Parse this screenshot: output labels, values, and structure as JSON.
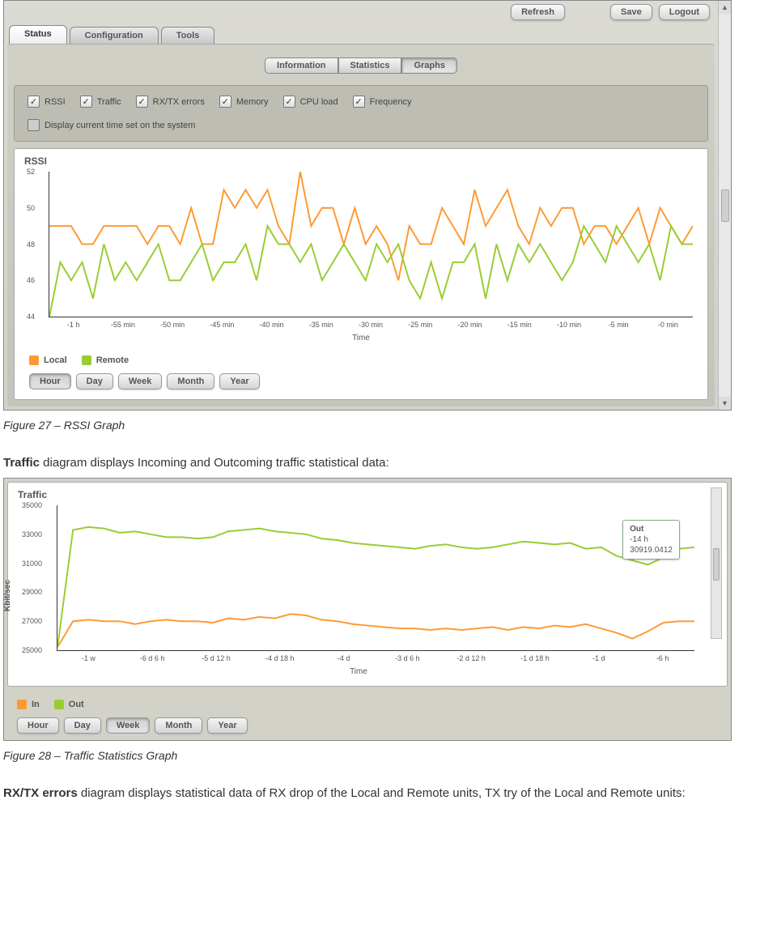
{
  "header_buttons": {
    "refresh": "Refresh",
    "save": "Save",
    "logout": "Logout"
  },
  "main_tabs": [
    {
      "label": "Status",
      "active": true
    },
    {
      "label": "Configuration",
      "active": false
    },
    {
      "label": "Tools",
      "active": false
    }
  ],
  "sub_tabs": [
    {
      "label": "Information",
      "active": false
    },
    {
      "label": "Statistics",
      "active": false
    },
    {
      "label": "Graphs",
      "active": true
    }
  ],
  "checkboxes": [
    {
      "label": "RSSI",
      "checked": true
    },
    {
      "label": "Traffic",
      "checked": true
    },
    {
      "label": "RX/TX errors",
      "checked": true
    },
    {
      "label": "Memory",
      "checked": true
    },
    {
      "label": "CPU load",
      "checked": true
    },
    {
      "label": "Frequency",
      "checked": true
    }
  ],
  "display_time": {
    "label": "Display current time set on the system",
    "checked": false
  },
  "rssi_chart": {
    "title": "RSSI",
    "xlabel": "Time",
    "legend": [
      {
        "label": "Local",
        "color": "#ff9933"
      },
      {
        "label": "Remote",
        "color": "#99cc33"
      }
    ],
    "range_buttons": [
      "Hour",
      "Day",
      "Week",
      "Month",
      "Year"
    ],
    "active_range": "Hour"
  },
  "traffic_chart": {
    "title": "Traffic",
    "ylabel": "Kbit/sec",
    "xlabel": "Time",
    "legend": [
      {
        "label": "In",
        "color": "#ff9933"
      },
      {
        "label": "Out",
        "color": "#99cc33"
      }
    ],
    "range_buttons": [
      "Hour",
      "Day",
      "Week",
      "Month",
      "Year"
    ],
    "active_range": "Week",
    "tooltip": {
      "title": "Out",
      "line1": "-14 h",
      "line2": "30919.0412"
    }
  },
  "captions": {
    "fig27": "Figure 27 – RSSI Graph",
    "fig28": "Figure 28 – Traffic Statistics Graph"
  },
  "text": {
    "traffic_intro_bold": "Traffic",
    "traffic_intro_rest": " diagram displays Incoming and Outcoming traffic statistical data:",
    "rxtx_intro_bold": "RX/TX errors",
    "rxtx_intro_rest": " diagram displays statistical data of RX drop of the Local and Remote units, TX try of the Local and Remote units:"
  },
  "chart_data": [
    {
      "type": "line",
      "title": "RSSI",
      "xlabel": "Time",
      "ylabel": "",
      "ylim": [
        44,
        52
      ],
      "categories": [
        "-1 h",
        "-55 min",
        "-50 min",
        "-45 min",
        "-40 min",
        "-35 min",
        "-30 min",
        "-25 min",
        "-20 min",
        "-15 min",
        "-10 min",
        "-5 min",
        "-0 min"
      ],
      "series": [
        {
          "name": "Local",
          "color": "#ff9933",
          "values": [
            49,
            49,
            49,
            48,
            48,
            49,
            49,
            49,
            49,
            48,
            49,
            49,
            48,
            50,
            48,
            48,
            51,
            50,
            51,
            50,
            51,
            49,
            48,
            52,
            49,
            50,
            50,
            48,
            50,
            48,
            49,
            48,
            46,
            49,
            48,
            48,
            50,
            49,
            48,
            51,
            49,
            50,
            51,
            49,
            48,
            50,
            49,
            50,
            50,
            48,
            49,
            49,
            48,
            49,
            50,
            48,
            50,
            49,
            48,
            49
          ]
        },
        {
          "name": "Remote",
          "color": "#99cc33",
          "values": [
            44,
            47,
            46,
            47,
            45,
            48,
            46,
            47,
            46,
            47,
            48,
            46,
            46,
            47,
            48,
            46,
            47,
            47,
            48,
            46,
            49,
            48,
            48,
            47,
            48,
            46,
            47,
            48,
            47,
            46,
            48,
            47,
            48,
            46,
            45,
            47,
            45,
            47,
            47,
            48,
            45,
            48,
            46,
            48,
            47,
            48,
            47,
            46,
            47,
            49,
            48,
            47,
            49,
            48,
            47,
            48,
            46,
            49,
            48,
            48
          ]
        }
      ]
    },
    {
      "type": "line",
      "title": "Traffic",
      "xlabel": "Time",
      "ylabel": "Kbit/sec",
      "ylim": [
        25000,
        35000
      ],
      "categories": [
        "-1 w",
        "-6 d 6 h",
        "-5 d 12 h",
        "-4 d 18 h",
        "-4 d",
        "-3 d 6 h",
        "-2 d 12 h",
        "-1 d 18 h",
        "-1 d",
        "-6 h"
      ],
      "series": [
        {
          "name": "In",
          "color": "#ff9933",
          "values": [
            25200,
            27000,
            27100,
            27000,
            27000,
            26800,
            27000,
            27100,
            27000,
            27000,
            26900,
            27200,
            27100,
            27300,
            27200,
            27500,
            27400,
            27100,
            27000,
            26800,
            26700,
            26600,
            26500,
            26500,
            26400,
            26500,
            26400,
            26500,
            26600,
            26400,
            26600,
            26500,
            26700,
            26600,
            26800,
            26500,
            26200,
            25800,
            26300,
            26900,
            27000,
            27000
          ]
        },
        {
          "name": "Out",
          "color": "#99cc33",
          "values": [
            25200,
            33300,
            33500,
            33400,
            33100,
            33200,
            33000,
            32800,
            32800,
            32700,
            32800,
            33200,
            33300,
            33400,
            33200,
            33100,
            33000,
            32700,
            32600,
            32400,
            32300,
            32200,
            32100,
            32000,
            32200,
            32300,
            32100,
            32000,
            32100,
            32300,
            32500,
            32400,
            32300,
            32400,
            32000,
            32100,
            31500,
            31200,
            30900,
            31400,
            32000,
            32100
          ]
        }
      ]
    }
  ]
}
